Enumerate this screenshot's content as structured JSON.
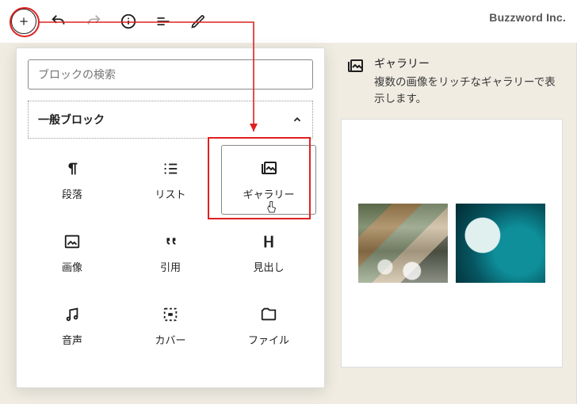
{
  "brand": "Buzzword Inc.",
  "toolbar": {
    "add_icon_title": "ブロックの追加"
  },
  "inserter": {
    "search_placeholder": "ブロックの検索",
    "section_title": "一般ブロック",
    "blocks": {
      "paragraph": "段落",
      "list": "リスト",
      "gallery": "ギャラリー",
      "image": "画像",
      "quote": "引用",
      "heading": "見出し",
      "audio": "音声",
      "cover": "カバー",
      "file": "ファイル"
    }
  },
  "preview": {
    "title": "ギャラリー",
    "desc": "複数の画像をリッチなギャラリーで表示します。"
  }
}
